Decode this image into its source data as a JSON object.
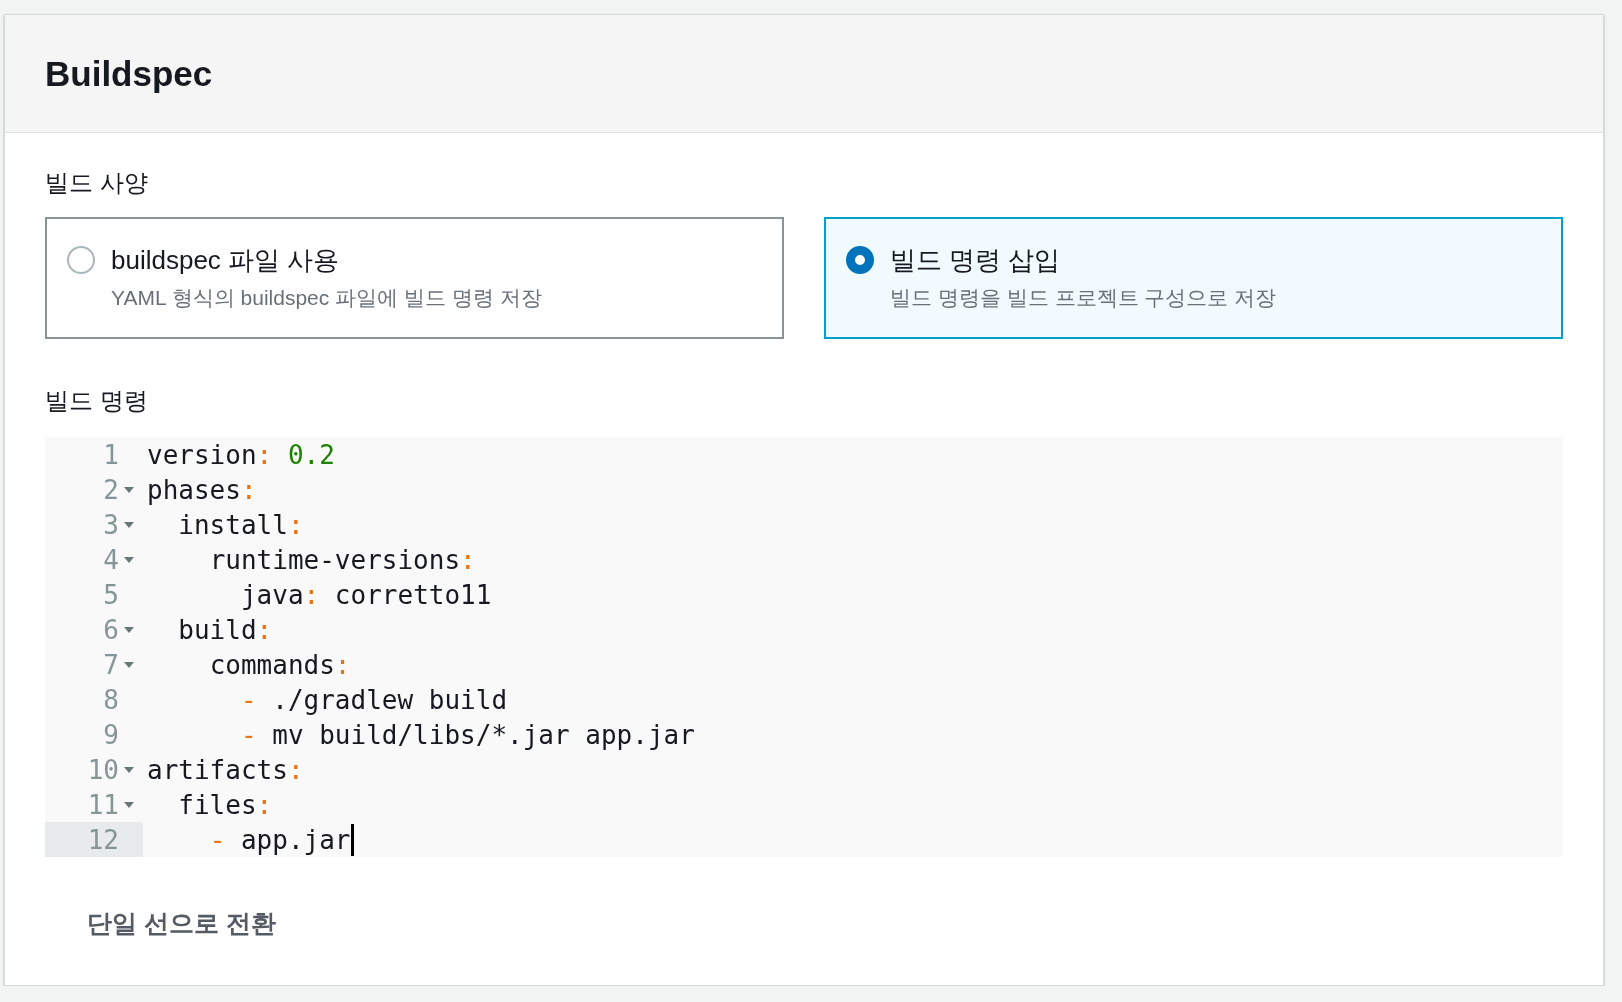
{
  "panel": {
    "title": "Buildspec"
  },
  "spec": {
    "label": "빌드 사양",
    "options": [
      {
        "title": "buildspec 파일 사용",
        "description": "YAML 형식의 buildspec 파일에 빌드 명령 저장",
        "selected": false
      },
      {
        "title": "빌드 명령 삽입",
        "description": "빌드 명령을 빌드 프로젝트 구성으로 저장",
        "selected": true
      }
    ]
  },
  "editor": {
    "label": "빌드 명령",
    "lines": [
      {
        "number": "1",
        "text": "version: 0.2",
        "foldable": false,
        "active": false
      },
      {
        "number": "2",
        "text": "phases:",
        "foldable": true,
        "active": false
      },
      {
        "number": "3",
        "text": "  install:",
        "foldable": true,
        "active": false
      },
      {
        "number": "4",
        "text": "    runtime-versions:",
        "foldable": true,
        "active": false
      },
      {
        "number": "5",
        "text": "      java: corretto11",
        "foldable": false,
        "active": false
      },
      {
        "number": "6",
        "text": "  build:",
        "foldable": true,
        "active": false
      },
      {
        "number": "7",
        "text": "    commands:",
        "foldable": true,
        "active": false
      },
      {
        "number": "8",
        "text": "      - ./gradlew build",
        "foldable": false,
        "active": false
      },
      {
        "number": "9",
        "text": "      - mv build/libs/*.jar app.jar",
        "foldable": false,
        "active": false
      },
      {
        "number": "10",
        "text": "artifacts:",
        "foldable": true,
        "active": false
      },
      {
        "number": "11",
        "text": "  files:",
        "foldable": true,
        "active": false
      },
      {
        "number": "12",
        "text": "    - app.jar",
        "foldable": false,
        "active": true
      }
    ]
  },
  "toggle_link": "단일 선으로 전환"
}
